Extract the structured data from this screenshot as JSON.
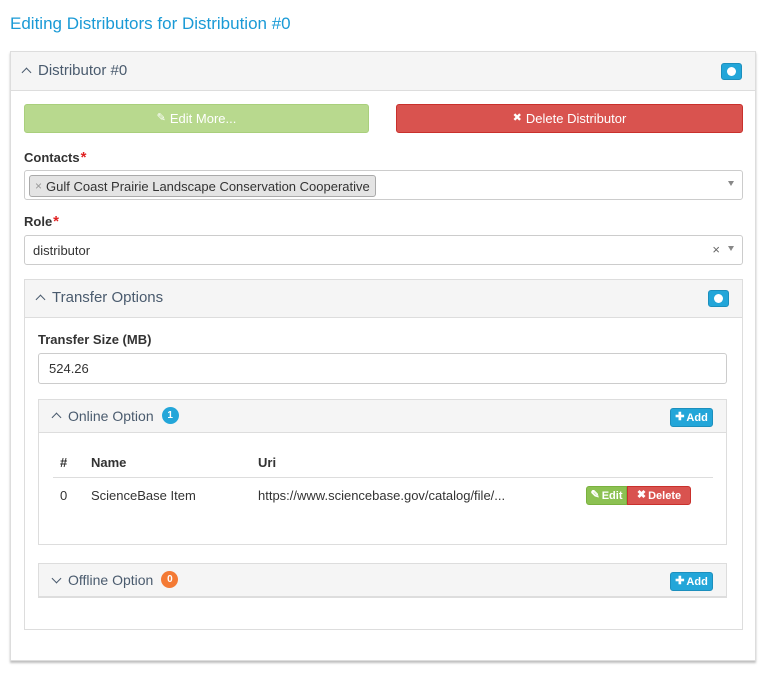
{
  "page": {
    "title": "Editing Distributors for Distribution #0"
  },
  "distributor": {
    "title": "Distributor #0",
    "edit_more_label": "Edit More...",
    "delete_label": "Delete Distributor",
    "contacts": {
      "label": "Contacts",
      "required_mark": "*",
      "selected": [
        "Gulf Coast Prairie Landscape Conservation Cooperative"
      ]
    },
    "role": {
      "label": "Role",
      "required_mark": "*",
      "value": "distributor"
    }
  },
  "transfer": {
    "title": "Transfer Options",
    "size_label": "Transfer Size (MB)",
    "size_value": "524.26",
    "online": {
      "title": "Online Option",
      "count": "1",
      "add_label": "Add",
      "columns": [
        "#",
        "Name",
        "Uri"
      ],
      "rows": [
        {
          "index": "0",
          "name": "ScienceBase Item",
          "uri": "https://www.sciencebase.gov/catalog/file/..."
        }
      ],
      "edit_label": "Edit",
      "delete_label": "Delete"
    },
    "offline": {
      "title": "Offline Option",
      "count": "0",
      "add_label": "Add"
    }
  },
  "colors": {
    "accent": "#23a6d9",
    "danger": "#d9534f",
    "success": "#8cc152",
    "warning": "#f47a34",
    "title": "#1a9ad6"
  }
}
